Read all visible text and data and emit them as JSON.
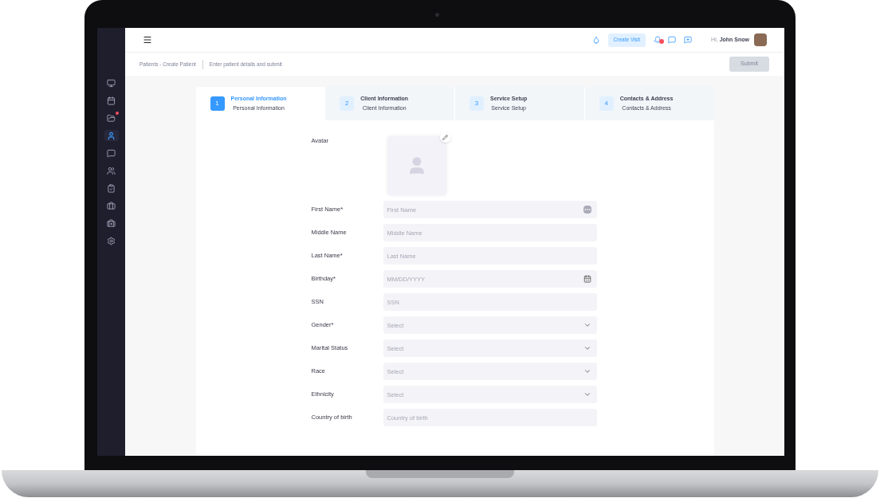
{
  "topbar": {
    "create_visit": "Create Visit",
    "greeting": "Hi,",
    "user_name": "John Snow",
    "notification_badge": true
  },
  "sidebar": {
    "items": [
      {
        "kind": "monitor",
        "selected": false,
        "alert": false
      },
      {
        "kind": "calendar",
        "selected": false,
        "alert": false
      },
      {
        "kind": "folder",
        "selected": false,
        "alert": true
      },
      {
        "kind": "person",
        "selected": true,
        "alert": false
      },
      {
        "kind": "message",
        "selected": false,
        "alert": false
      },
      {
        "kind": "people",
        "selected": false,
        "alert": false
      },
      {
        "kind": "clipboard",
        "selected": false,
        "alert": false
      },
      {
        "kind": "briefcase",
        "selected": false,
        "alert": false
      },
      {
        "kind": "medkit",
        "selected": false,
        "alert": false
      },
      {
        "kind": "settings",
        "selected": false,
        "alert": false
      }
    ]
  },
  "breadcrumb": {
    "path": "Patients - Create Patient",
    "hint": "Enter patient details and submit"
  },
  "submit": {
    "label": "Submit",
    "disabled": true
  },
  "steps": [
    {
      "number": "1",
      "title": "Personal Information",
      "subtitle": "Personal Information",
      "selected": true
    },
    {
      "number": "2",
      "title": "Client Information",
      "subtitle": "Client Information",
      "selected": false
    },
    {
      "number": "3",
      "title": "Service Setup",
      "subtitle": "Service Setup",
      "selected": false
    },
    {
      "number": "4",
      "title": "Contacts & Address",
      "subtitle": "Contacts & Address",
      "selected": false
    }
  ],
  "form": {
    "avatar_label": "Avatar",
    "fields": [
      {
        "label": "First Name*",
        "placeholder": "First Name",
        "kind": "text-more"
      },
      {
        "label": "Middle Name",
        "placeholder": "Middle Name",
        "kind": "text"
      },
      {
        "label": "Last Name*",
        "placeholder": "Last Name",
        "kind": "text"
      },
      {
        "label": "Birthday*",
        "placeholder": "MM/DD/YYYY",
        "kind": "date"
      },
      {
        "label": "SSN",
        "placeholder": "SSN",
        "kind": "text"
      },
      {
        "label": "Gender*",
        "placeholder": "Select",
        "kind": "select"
      },
      {
        "label": "Marital Status",
        "placeholder": "Select",
        "kind": "select"
      },
      {
        "label": "Race",
        "placeholder": "Select",
        "kind": "select"
      },
      {
        "label": "Ethnicity",
        "placeholder": "Select",
        "kind": "select"
      },
      {
        "label": "Country of birth",
        "placeholder": "Country of birth",
        "kind": "text"
      }
    ]
  }
}
